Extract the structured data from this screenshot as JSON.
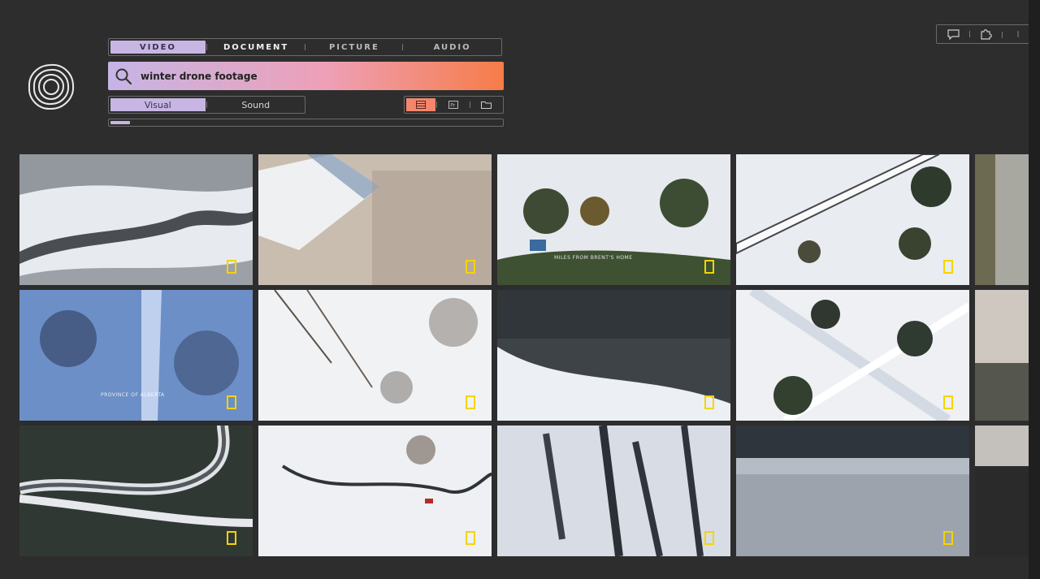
{
  "tabs": [
    {
      "label": "VIDEO",
      "active": true
    },
    {
      "label": "DOCUMENT",
      "active": false
    },
    {
      "label": "PICTURE",
      "active": false
    },
    {
      "label": "AUDIO",
      "active": false
    }
  ],
  "search": {
    "value": "winter drone footage"
  },
  "modes": [
    {
      "label": "Visual",
      "active": true
    },
    {
      "label": "Sound",
      "active": false
    }
  ],
  "view_buttons": [
    {
      "icon": "grid-view-icon",
      "active": true
    },
    {
      "icon": "premiere-icon",
      "active": false
    },
    {
      "icon": "folder-icon",
      "active": false
    }
  ],
  "progress": {
    "fraction": 0.05
  },
  "top_tools": [
    {
      "icon": "comment-icon"
    },
    {
      "icon": "puzzle-icon"
    }
  ],
  "thumbnails": [
    {
      "scene": "river",
      "caption": ""
    },
    {
      "scene": "roof",
      "caption": ""
    },
    {
      "scene": "forest-house",
      "caption": "MILES FROM BRENT'S HOME"
    },
    {
      "scene": "road-diagonal",
      "caption": ""
    },
    {
      "scene": "partial-trees",
      "caption": ""
    },
    {
      "scene": "blue-trees",
      "caption": "PROVINCE OF ALBERTA"
    },
    {
      "scene": "snow-branches",
      "caption": ""
    },
    {
      "scene": "pine-river",
      "caption": ""
    },
    {
      "scene": "cross-path",
      "caption": ""
    },
    {
      "scene": "partial-horizon",
      "caption": ""
    },
    {
      "scene": "winding-road",
      "caption": ""
    },
    {
      "scene": "creek",
      "caption": ""
    },
    {
      "scene": "pines",
      "caption": ""
    },
    {
      "scene": "dense-forest",
      "caption": ""
    },
    {
      "scene": "partial-dusk",
      "caption": ""
    }
  ],
  "colors": {
    "accent_lavender": "#c7b6e4",
    "accent_orange": "#f67c48",
    "badge_yellow": "#f5d400"
  }
}
